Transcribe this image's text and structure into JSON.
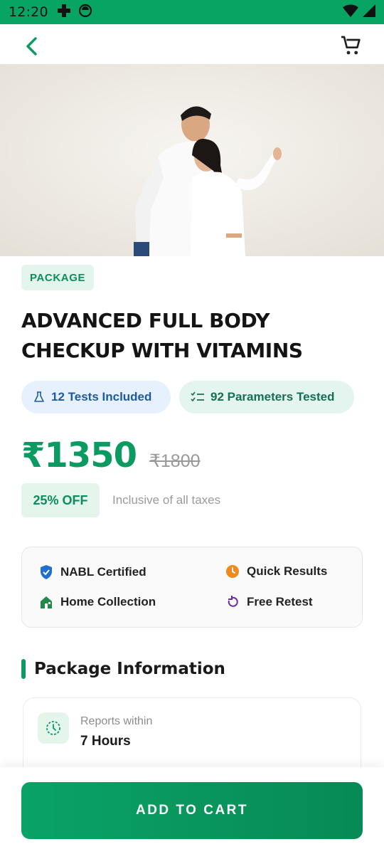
{
  "status_bar": {
    "time": "12:20"
  },
  "package_badge": "PACKAGE",
  "title": "ADVANCED FULL BODY CHECKUP WITH VITAMINS",
  "chips": {
    "tests": "12 Tests Included",
    "parameters": "92 Parameters Tested"
  },
  "price": {
    "current": "₹1350",
    "mrp": "₹1800",
    "discount": "25% OFF",
    "tax_note": "Inclusive of all taxes"
  },
  "features": {
    "nabl": "NABL Certified",
    "quick": "Quick Results",
    "home": "Home Collection",
    "retest": "Free Retest"
  },
  "section": {
    "title": "Package Information"
  },
  "info": {
    "label": "Reports within",
    "value": "7 Hours"
  },
  "cta": {
    "label": "ADD TO CART"
  },
  "colors": {
    "brand": "#0b9a61",
    "status_bar": "#08a464"
  }
}
